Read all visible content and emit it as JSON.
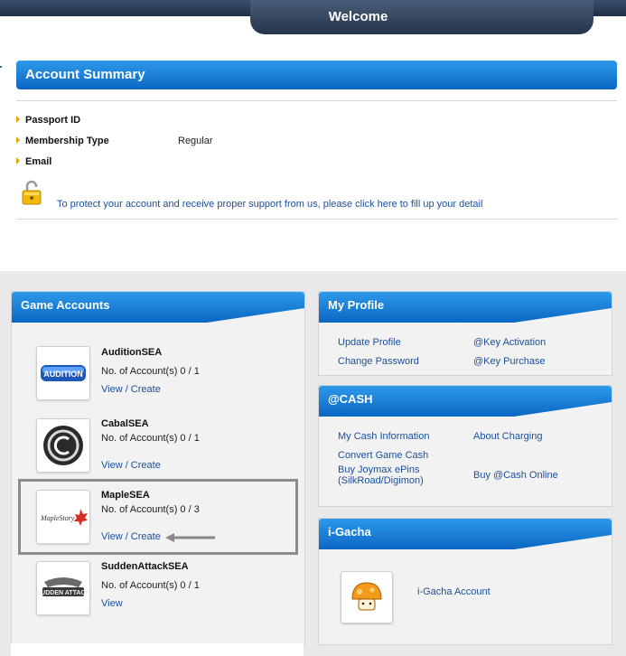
{
  "header": {
    "title": "Welcome"
  },
  "account_summary": {
    "title": "Account Summary",
    "fields": [
      {
        "label": "Passport ID",
        "value": ""
      },
      {
        "label": "Membership Type",
        "value": "Regular"
      },
      {
        "label": "Email",
        "value": ""
      }
    ],
    "protect_text": "To protect your account and receive proper support from us, please click here to fill up your detail"
  },
  "game_accounts": {
    "title": "Game Accounts",
    "games": [
      {
        "name": "AuditionSEA",
        "count": "No. of Account(s) 0 / 1",
        "links": "View / Create",
        "logo": "audition-logo"
      },
      {
        "name": "CabalSEA",
        "count": "No. of Account(s) 0 / 1",
        "links": "View / Create",
        "logo": "cabal-logo"
      },
      {
        "name": "MapleSEA",
        "count": "No. of Account(s) 0 / 3",
        "links": "View / Create",
        "logo": "maplestory-logo"
      },
      {
        "name": "SuddenAttackSEA",
        "count": "No. of Account(s) 0 / 1",
        "links": "View",
        "logo": "sudden-attack-logo"
      }
    ]
  },
  "my_profile": {
    "title": "My Profile",
    "links": [
      "Update Profile",
      "@Key Activation",
      "Change Password",
      "@Key Purchase"
    ]
  },
  "cash": {
    "title": "@CASH",
    "links": [
      "My Cash Information",
      "About Charging",
      "Convert Game Cash",
      "Buy Joymax ePins (SilkRoad/Digimon)",
      "Buy @Cash Online"
    ]
  },
  "gacha": {
    "title": "i-Gacha",
    "link": "i-Gacha Account"
  },
  "colors": {
    "accent_blue": "#0b66c3",
    "link": "#1b4f9c",
    "bullet": "#e8a300"
  }
}
